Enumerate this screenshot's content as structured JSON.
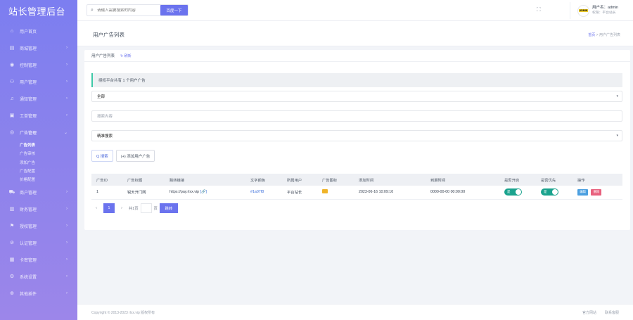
{
  "brand": "站长管理后台",
  "sidebar": {
    "items": [
      {
        "label": "用户首页",
        "icon": "home-icon",
        "glyph": "⌂",
        "chev": false
      },
      {
        "label": "商城管理",
        "icon": "grid-icon",
        "glyph": "▤",
        "chev": true
      },
      {
        "label": "控制管理",
        "icon": "target-icon",
        "glyph": "◉",
        "chev": true
      },
      {
        "label": "用户管理",
        "icon": "user-icon",
        "glyph": "⚇",
        "chev": true
      },
      {
        "label": "通知管理",
        "icon": "bell-icon",
        "glyph": "♫",
        "chev": true
      },
      {
        "label": "工单管理",
        "icon": "ticket-icon",
        "glyph": "▣",
        "chev": true
      }
    ],
    "open_item": {
      "label": "广告管理",
      "icon": "eye-icon",
      "glyph": "◎"
    },
    "sub_items": [
      "广告列表",
      "广告审核",
      "添加广告",
      "广告配置",
      "价格配置"
    ],
    "items_after": [
      {
        "label": "商户管理",
        "icon": "cart-icon",
        "glyph": "⛟",
        "chev": true
      },
      {
        "label": "财务管理",
        "icon": "chart-icon",
        "glyph": "▥",
        "chev": true
      },
      {
        "label": "授权管理",
        "icon": "flag-icon",
        "glyph": "⚑",
        "chev": true
      },
      {
        "label": "认证管理",
        "icon": "shield-icon",
        "glyph": "⊘",
        "chev": true
      },
      {
        "label": "卡密管理",
        "icon": "calendar-icon",
        "glyph": "▦",
        "chev": true
      },
      {
        "label": "系统设置",
        "icon": "gear-icon",
        "glyph": "⚙",
        "chev": true
      },
      {
        "label": "其他插件",
        "icon": "plugin-icon",
        "glyph": "⊕",
        "chev": true
      }
    ]
  },
  "topbar": {
    "search_placeholder": "请输入需要搜索的内容",
    "search_button": "百度一下",
    "user_name": "用户名：admin",
    "user_role": "权限：平台站长",
    "avatar_text": "ADMIN"
  },
  "page": {
    "title": "用户广告列表",
    "breadcrumb_home": "首页",
    "breadcrumb_sep": ">",
    "breadcrumb_current": "用户广告列表"
  },
  "card": {
    "header": "用户广告列表",
    "refresh": "刷新",
    "tip": "授权平台共有 1 个用户广告",
    "select_type": "全部",
    "search_placeholder": "搜索内容",
    "select_field": "精准搜索",
    "btn_search": "Q 搜索",
    "btn_add": "(+) 添加用户广告"
  },
  "table": {
    "headers": [
      "广告ID",
      "广告标题",
      "跳转链接",
      "文字颜色",
      "所属用户",
      "广告图标",
      "添加时间",
      "到期时间",
      "是否开启",
      "是否优先",
      "操作"
    ],
    "rows": [
      {
        "id": "1",
        "title": "锐天开门网",
        "url": "https://pay.rlxx.vip",
        "color": "#1a07f8",
        "owner": "平台站长",
        "added": "2023-06-16 10:09:10",
        "expires": "0000-00-00 00:00:00",
        "enabled": "是",
        "priority": "是",
        "edit": "编辑",
        "delete": "删除"
      }
    ]
  },
  "pager": {
    "prev": "‹",
    "current": "1",
    "next": "›",
    "total": "共1页",
    "goto_unit": "页",
    "go": "跳转"
  },
  "footer": {
    "copyright": "Copyright © 2013-2023 rlxx.vip 版权所有",
    "link1": "官方网站",
    "link2": "联系客服"
  },
  "colors": {
    "accent": "#6b73ee",
    "success": "#1aa38e",
    "danger": "#e8617e"
  }
}
